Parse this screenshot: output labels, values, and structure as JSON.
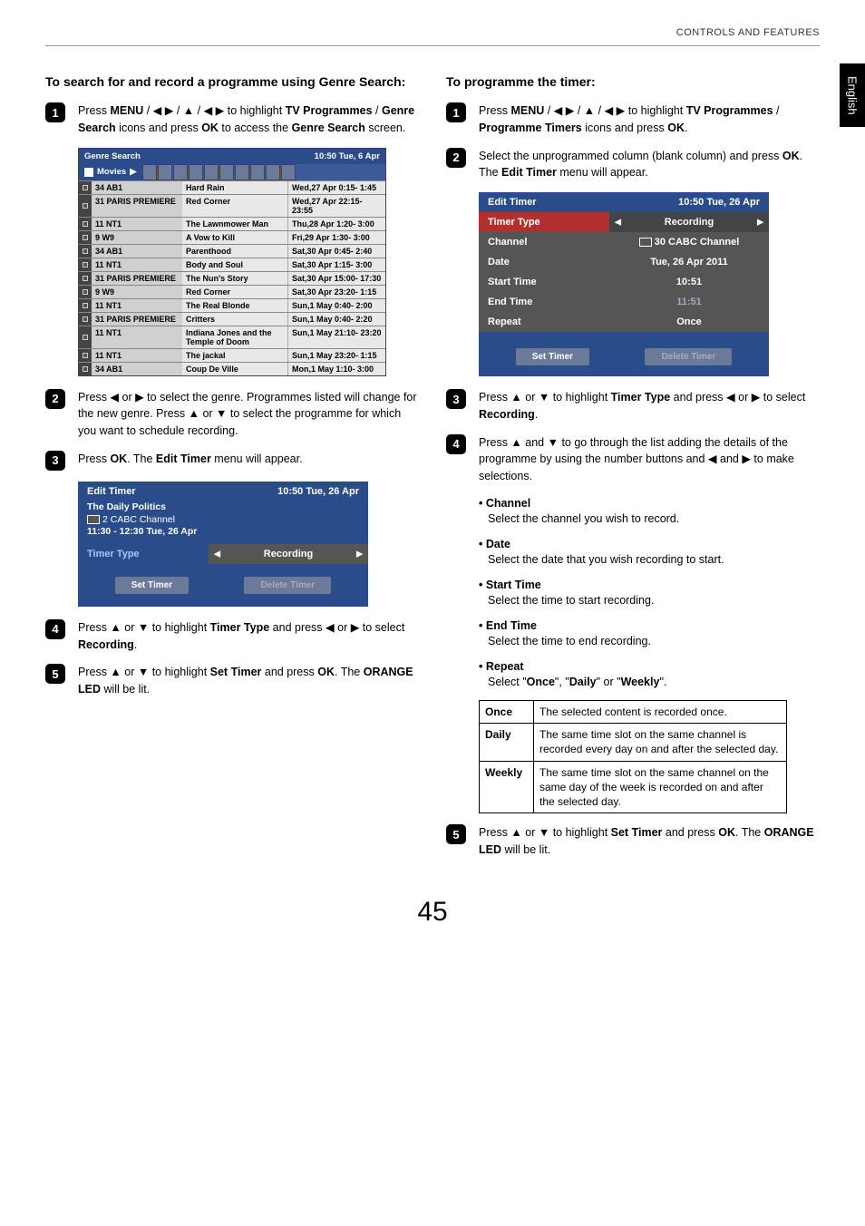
{
  "header": "CONTROLS AND FEATURES",
  "side_tab": "English",
  "page_number": "45",
  "left": {
    "title": "To search for and record a programme using Genre Search:",
    "step1": {
      "p1": "Press ",
      "b1": "MENU",
      "p2": " / ◀ ▶ / ▲ / ◀ ▶ to highlight ",
      "b2": "TV Programmes",
      "p3": " / ",
      "b3": "Genre Search",
      "p4": " icons and press ",
      "b4": "OK",
      "p5": " to access the ",
      "b5": "Genre Search",
      "p6": " screen."
    },
    "step2": "Press ◀ or ▶ to select the genre. Programmes listed will change for the new genre. Press ▲ or ▼ to select the programme for which you want to schedule recording.",
    "step3": {
      "p1": "Press ",
      "b1": "OK",
      "p2": ". The ",
      "b2": "Edit Timer",
      "p3": " menu will appear."
    },
    "step4": {
      "p1": "Press ▲ or ▼ to highlight ",
      "b1": "Timer Type",
      "p2": " and press ◀ or ▶ to select ",
      "b2": "Recording",
      "p3": "."
    },
    "step5": {
      "p1": "Press ▲ or ▼ to highlight ",
      "b1": "Set Timer",
      "p2": " and press ",
      "b2": "OK",
      "p3": ". The ",
      "b3": "ORANGE LED",
      "p4": " will be lit."
    }
  },
  "right": {
    "title": "To programme the timer:",
    "step1": {
      "p1": "Press ",
      "b1": "MENU",
      "p2": " / ◀ ▶ / ▲ / ◀ ▶ to highlight ",
      "b2": "TV Programmes",
      "p3": " / ",
      "b3": "Programme Timers",
      "p4": " icons and press ",
      "b4": "OK",
      "p5": "."
    },
    "step2": {
      "p1": "Select the unprogrammed column (blank column) and press ",
      "b1": "OK",
      "p2": ".",
      "p3": "The ",
      "b2": "Edit Timer",
      "p4": " menu will appear."
    },
    "step3": {
      "p1": "Press ▲ or ▼ to highlight ",
      "b1": "Timer Type",
      "p2": " and press ◀ or ▶ to select ",
      "b2": "Recording",
      "p3": "."
    },
    "step4": "Press ▲ and ▼ to go through the list adding the details of the programme by using the number buttons and ◀ and ▶ to make selections.",
    "sub": {
      "channel": {
        "t": "Channel",
        "d": "Select the channel you wish to record."
      },
      "date": {
        "t": "Date",
        "d": "Select the date that you wish recording to start."
      },
      "start": {
        "t": "Start Time",
        "d": "Select the time to start recording."
      },
      "end": {
        "t": "End Time",
        "d": "Select the time to end recording."
      },
      "repeat": {
        "t": "Repeat",
        "d_p1": "Select \"",
        "d_b1": "Once",
        "d_p2": "\", \"",
        "d_b2": "Daily",
        "d_p3": "\" or \"",
        "d_b3": "Weekly",
        "d_p4": "\"."
      }
    },
    "repeat_table": {
      "once": {
        "l": "Once",
        "d": "The selected content is recorded once."
      },
      "daily": {
        "l": "Daily",
        "d": "The same time slot on the same channel is recorded every day on and after the selected day."
      },
      "weekly": {
        "l": "Weekly",
        "d": "The same time slot on the same channel on the same day of the week is recorded on and after the selected day."
      }
    },
    "step5": {
      "p1": "Press ▲ or ▼ to highlight ",
      "b1": "Set Timer",
      "p2": " and press ",
      "b2": "OK",
      "p3": ". The ",
      "b3": "ORANGE LED",
      "p4": " will be lit."
    }
  },
  "genre_panel": {
    "title": "Genre Search",
    "time": "10:50 Tue, 6 Apr",
    "tab": "Movies",
    "rows": [
      {
        "ch": "34 AB1",
        "prog": "Hard Rain",
        "t": "Wed,27 Apr  0:15- 1:45"
      },
      {
        "ch": "31 PARIS PREMIERE",
        "prog": "Red Corner",
        "t": "Wed,27 Apr 22:15- 23:55"
      },
      {
        "ch": "11 NT1",
        "prog": "The Lawnmower Man",
        "t": "Thu,28 Apr  1:20- 3:00"
      },
      {
        "ch": "9    W9",
        "prog": "A Vow to Kill",
        "t": "Fri,29 Apr  1:30- 3:00"
      },
      {
        "ch": "34 AB1",
        "prog": "Parenthood",
        "t": "Sat,30 Apr  0:45- 2:40"
      },
      {
        "ch": "11 NT1",
        "prog": "Body and Soul",
        "t": "Sat,30 Apr  1:15- 3:00"
      },
      {
        "ch": "31 PARIS PREMIERE",
        "prog": "The Nun's Story",
        "t": "Sat,30 Apr 15:00- 17:30"
      },
      {
        "ch": "9    W9",
        "prog": "Red Corner",
        "t": "Sat,30 Apr 23:20- 1:15"
      },
      {
        "ch": "11 NT1",
        "prog": "The Real Blonde",
        "t": "Sun,1 May  0:40-  2:00"
      },
      {
        "ch": "31 PARIS PREMIERE",
        "prog": "Critters",
        "t": "Sun,1 May  0:40-  2:20"
      },
      {
        "ch": "11 NT1",
        "prog": "Indiana Jones and the Temple of Doom",
        "t": "Sun,1 May 21:10- 23:20"
      },
      {
        "ch": "11 NT1",
        "prog": "The jackal",
        "t": "Sun,1 May 23:20-  1:15"
      },
      {
        "ch": "34 AB1",
        "prog": "Coup De Ville",
        "t": "Mon,1 May  1:10-  3:00"
      }
    ]
  },
  "et_panel": {
    "title": "Edit Timer",
    "time": "10:50 Tue, 26 Apr",
    "sub1": "The Daily Politics",
    "sub2_pre": "2 CABC Channel",
    "sub3": "11:30 - 12:30 Tue, 26 Apr",
    "row_l": "Timer Type",
    "row_r": "Recording",
    "btn1": "Set Timer",
    "btn2": "Delete Timer"
  },
  "et2_panel": {
    "title": "Edit Timer",
    "time": "10:50 Tue, 26 Apr",
    "rows": [
      {
        "l": "Timer Type",
        "r": "Recording",
        "bg": "red",
        "rbg": "dark",
        "arrows": true
      },
      {
        "l": "Channel",
        "r": "30 CABC Channel",
        "bg": "gray",
        "icon": true
      },
      {
        "l": "Date",
        "r": "Tue, 26 Apr 2011",
        "bg": "gray"
      },
      {
        "l": "Start Time",
        "r": "10:51",
        "bg": "gray"
      },
      {
        "l": "End Time",
        "r": "11:51",
        "bg": "gray",
        "dim": true
      },
      {
        "l": "Repeat",
        "r": "Once",
        "bg": "gray"
      }
    ],
    "btn1": "Set Timer",
    "btn2": "Delete Timer"
  }
}
